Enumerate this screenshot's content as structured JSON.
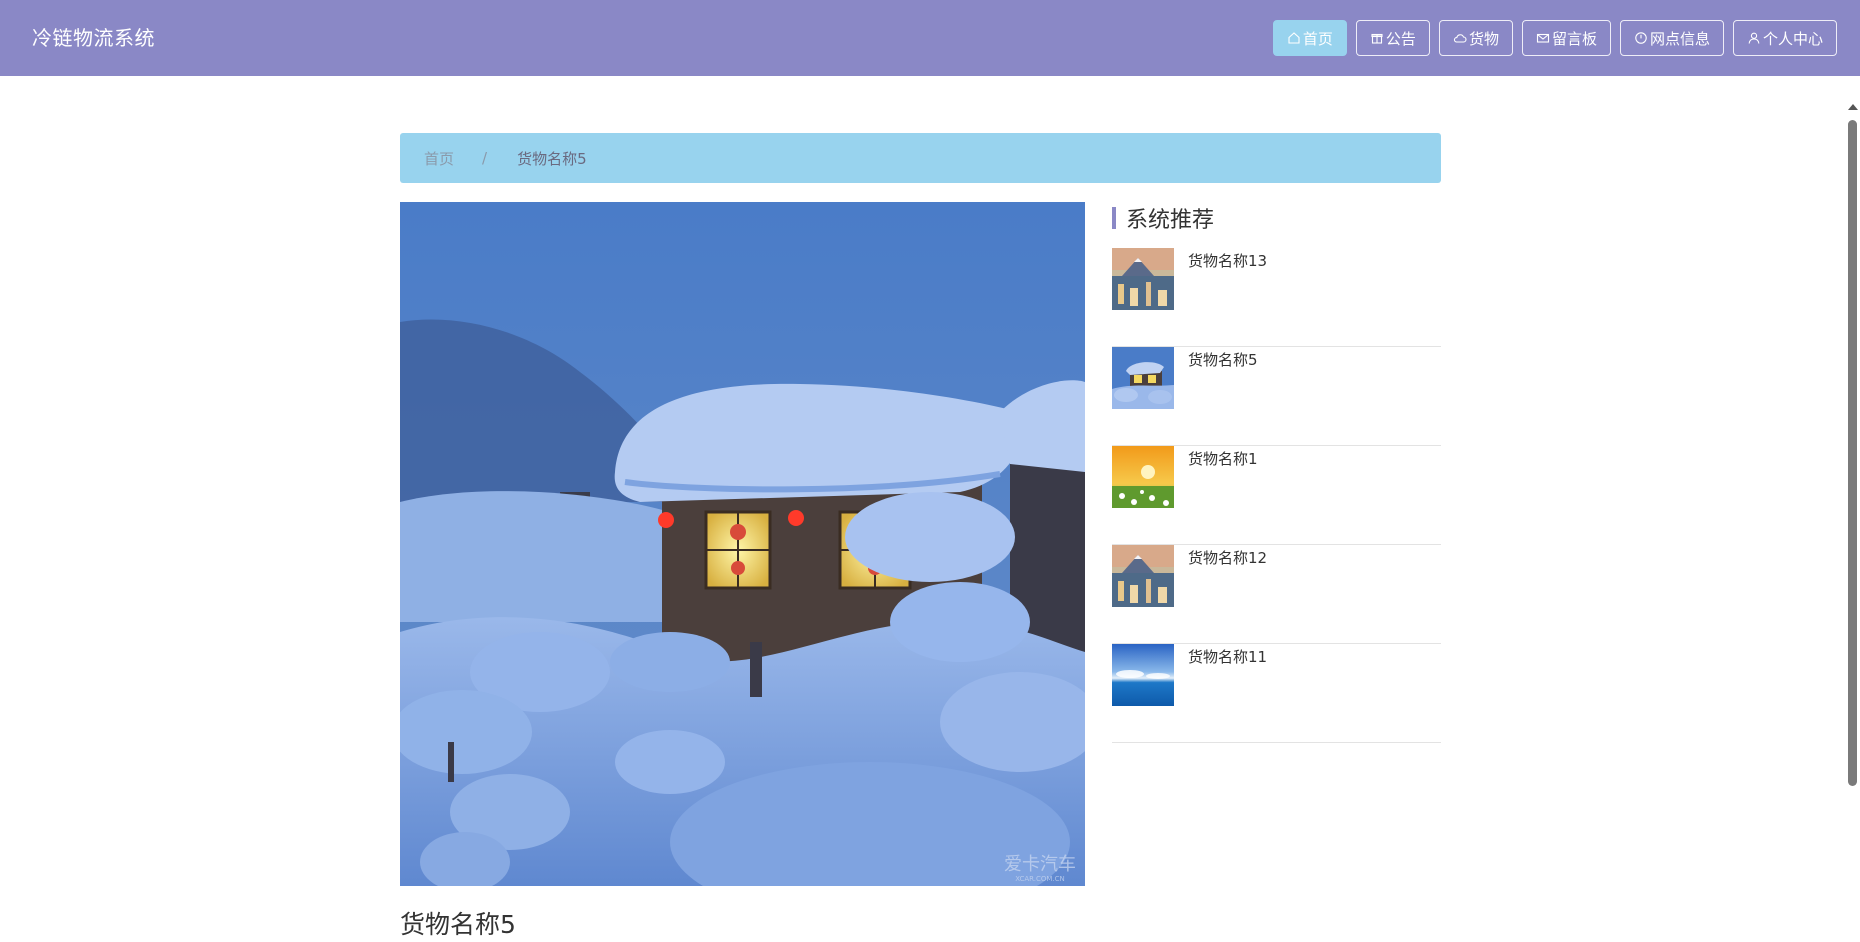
{
  "app": {
    "brand": "冷链物流系统"
  },
  "nav": {
    "items": [
      {
        "label": "首页",
        "icon": "home-icon",
        "active": true
      },
      {
        "label": "公告",
        "icon": "gift-icon",
        "active": false
      },
      {
        "label": "货物",
        "icon": "cloud-icon",
        "active": false
      },
      {
        "label": "留言板",
        "icon": "mail-icon",
        "active": false
      },
      {
        "label": "网点信息",
        "icon": "clock-icon",
        "active": false
      },
      {
        "label": "个人中心",
        "icon": "user-icon",
        "active": false
      }
    ]
  },
  "breadcrumb": {
    "home": "首页",
    "separator": "/",
    "current": "货物名称5"
  },
  "goods": {
    "title": "货物名称5",
    "image_watermark": "爱卡汽车",
    "image_watermark_sub": "XCAR.COM.CN"
  },
  "recommend": {
    "title": "系统推荐",
    "items": [
      {
        "name": "货物名称13",
        "thumb": "city-mountain"
      },
      {
        "name": "货物名称5",
        "thumb": "snow-house"
      },
      {
        "name": "货物名称1",
        "thumb": "sunset-flowers"
      },
      {
        "name": "货物名称12",
        "thumb": "city-mountain"
      },
      {
        "name": "货物名称11",
        "thumb": "sky-sea"
      }
    ]
  },
  "colors": {
    "header_bg": "#8a88c6",
    "active_nav_bg": "#98d3ee",
    "breadcrumb_bg": "#98d3ee",
    "accent_bar": "#8a88c6"
  }
}
